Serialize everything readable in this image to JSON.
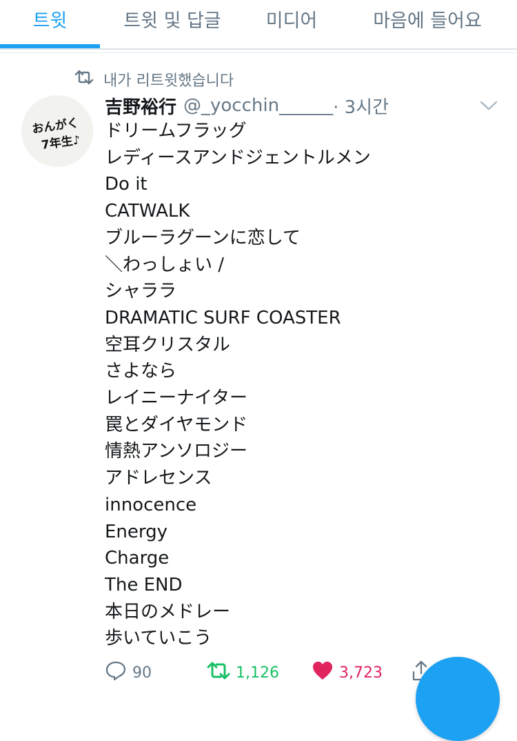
{
  "tabs": [
    {
      "label": "트윗"
    },
    {
      "label": "트윗 및 답글"
    },
    {
      "label": "미디어"
    },
    {
      "label": "마음에 들어요"
    }
  ],
  "retweet_context": {
    "text": "내가 리트윗했습니다",
    "icon": "retweet-icon"
  },
  "tweet": {
    "author_name": "吉野裕行",
    "handle": "@_yocchin______",
    "time": "· 3시간",
    "lines": [
      "ドリームフラッグ",
      "レディースアンドジェントルメン",
      "Do it",
      "CATWALK",
      "ブルーラグーンに恋して",
      "＼わっしょい /",
      "シャララ",
      "DRAMATIC SURF COASTER",
      "空耳クリスタル",
      "さよなら",
      "レイニーナイター",
      "罠とダイヤモンド",
      "情熱アンソロジー",
      "アドレセンス",
      "innocence",
      "Energy",
      "Charge",
      "The END",
      "本日のメドレー",
      "歩いていこう"
    ],
    "avatar_text": {
      "line1": "おんがく",
      "line2": "7年生♪"
    }
  },
  "actions": {
    "replies": "90",
    "retweets": "1,126",
    "likes": "3,723"
  },
  "colors": {
    "accent": "#1da1f2",
    "retweet_active": "#17bf63",
    "like_active": "#e0245e",
    "muted": "#657786"
  }
}
